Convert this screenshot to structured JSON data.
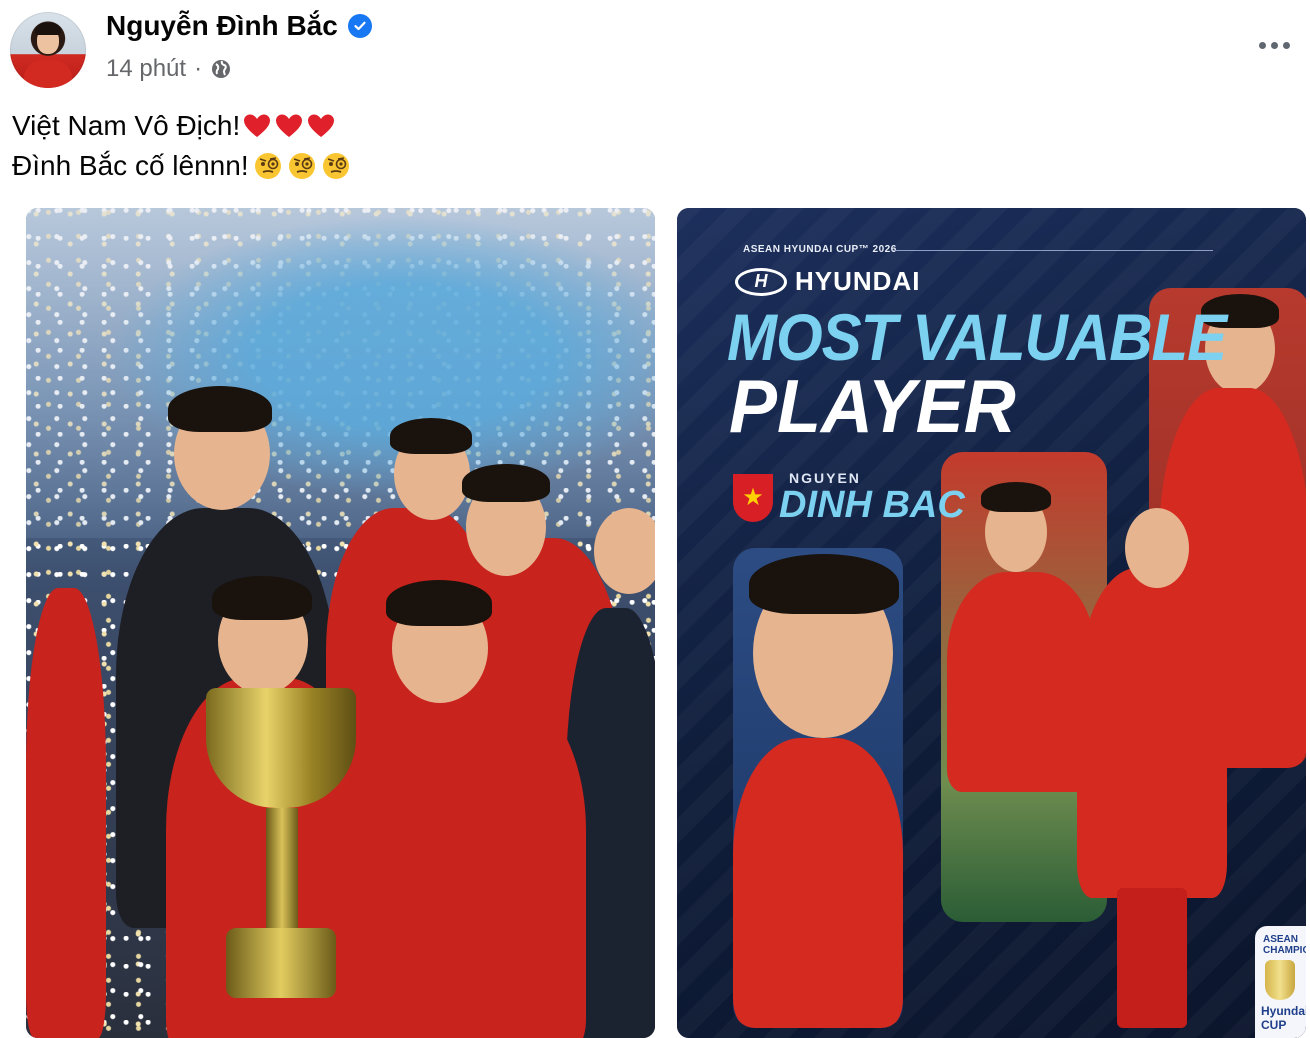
{
  "post": {
    "author_name": "Nguyễn Đình Bắc",
    "timestamp": "14 phút",
    "separator": "·",
    "caption_line1": "Việt Nam Vô Địch!",
    "caption_line2": "Đình Bắc cố lênnn!",
    "caption_line1_emojis": [
      "red-heart",
      "red-heart",
      "red-heart"
    ],
    "caption_line2_emojis": [
      "face-with-monocle",
      "face-with-monocle",
      "face-with-monocle"
    ],
    "more_options_icon": "more-horizontal-icon",
    "privacy_icon": "globe-icon"
  },
  "photos": {
    "right": {
      "cup_label": "ASEAN HYUNDAI CUP™ 2026",
      "sponsor": "HYUNDAI",
      "title_line1": "MOST VALUABLE",
      "title_line2": "PLAYER",
      "player_first_name": "NGUYEN",
      "player_last_name": "DINH BAC",
      "champ_badge_text": "ASEAN CHAMPIONS",
      "champ_badge_word": "Hyundai CUP"
    }
  },
  "colors": {
    "verified_blue": "#1877f2",
    "meta_gray": "#65676b",
    "text": "#050505",
    "mvp_cyan": "#7bd1ef",
    "mvp_navy": "#0f1d3a"
  }
}
